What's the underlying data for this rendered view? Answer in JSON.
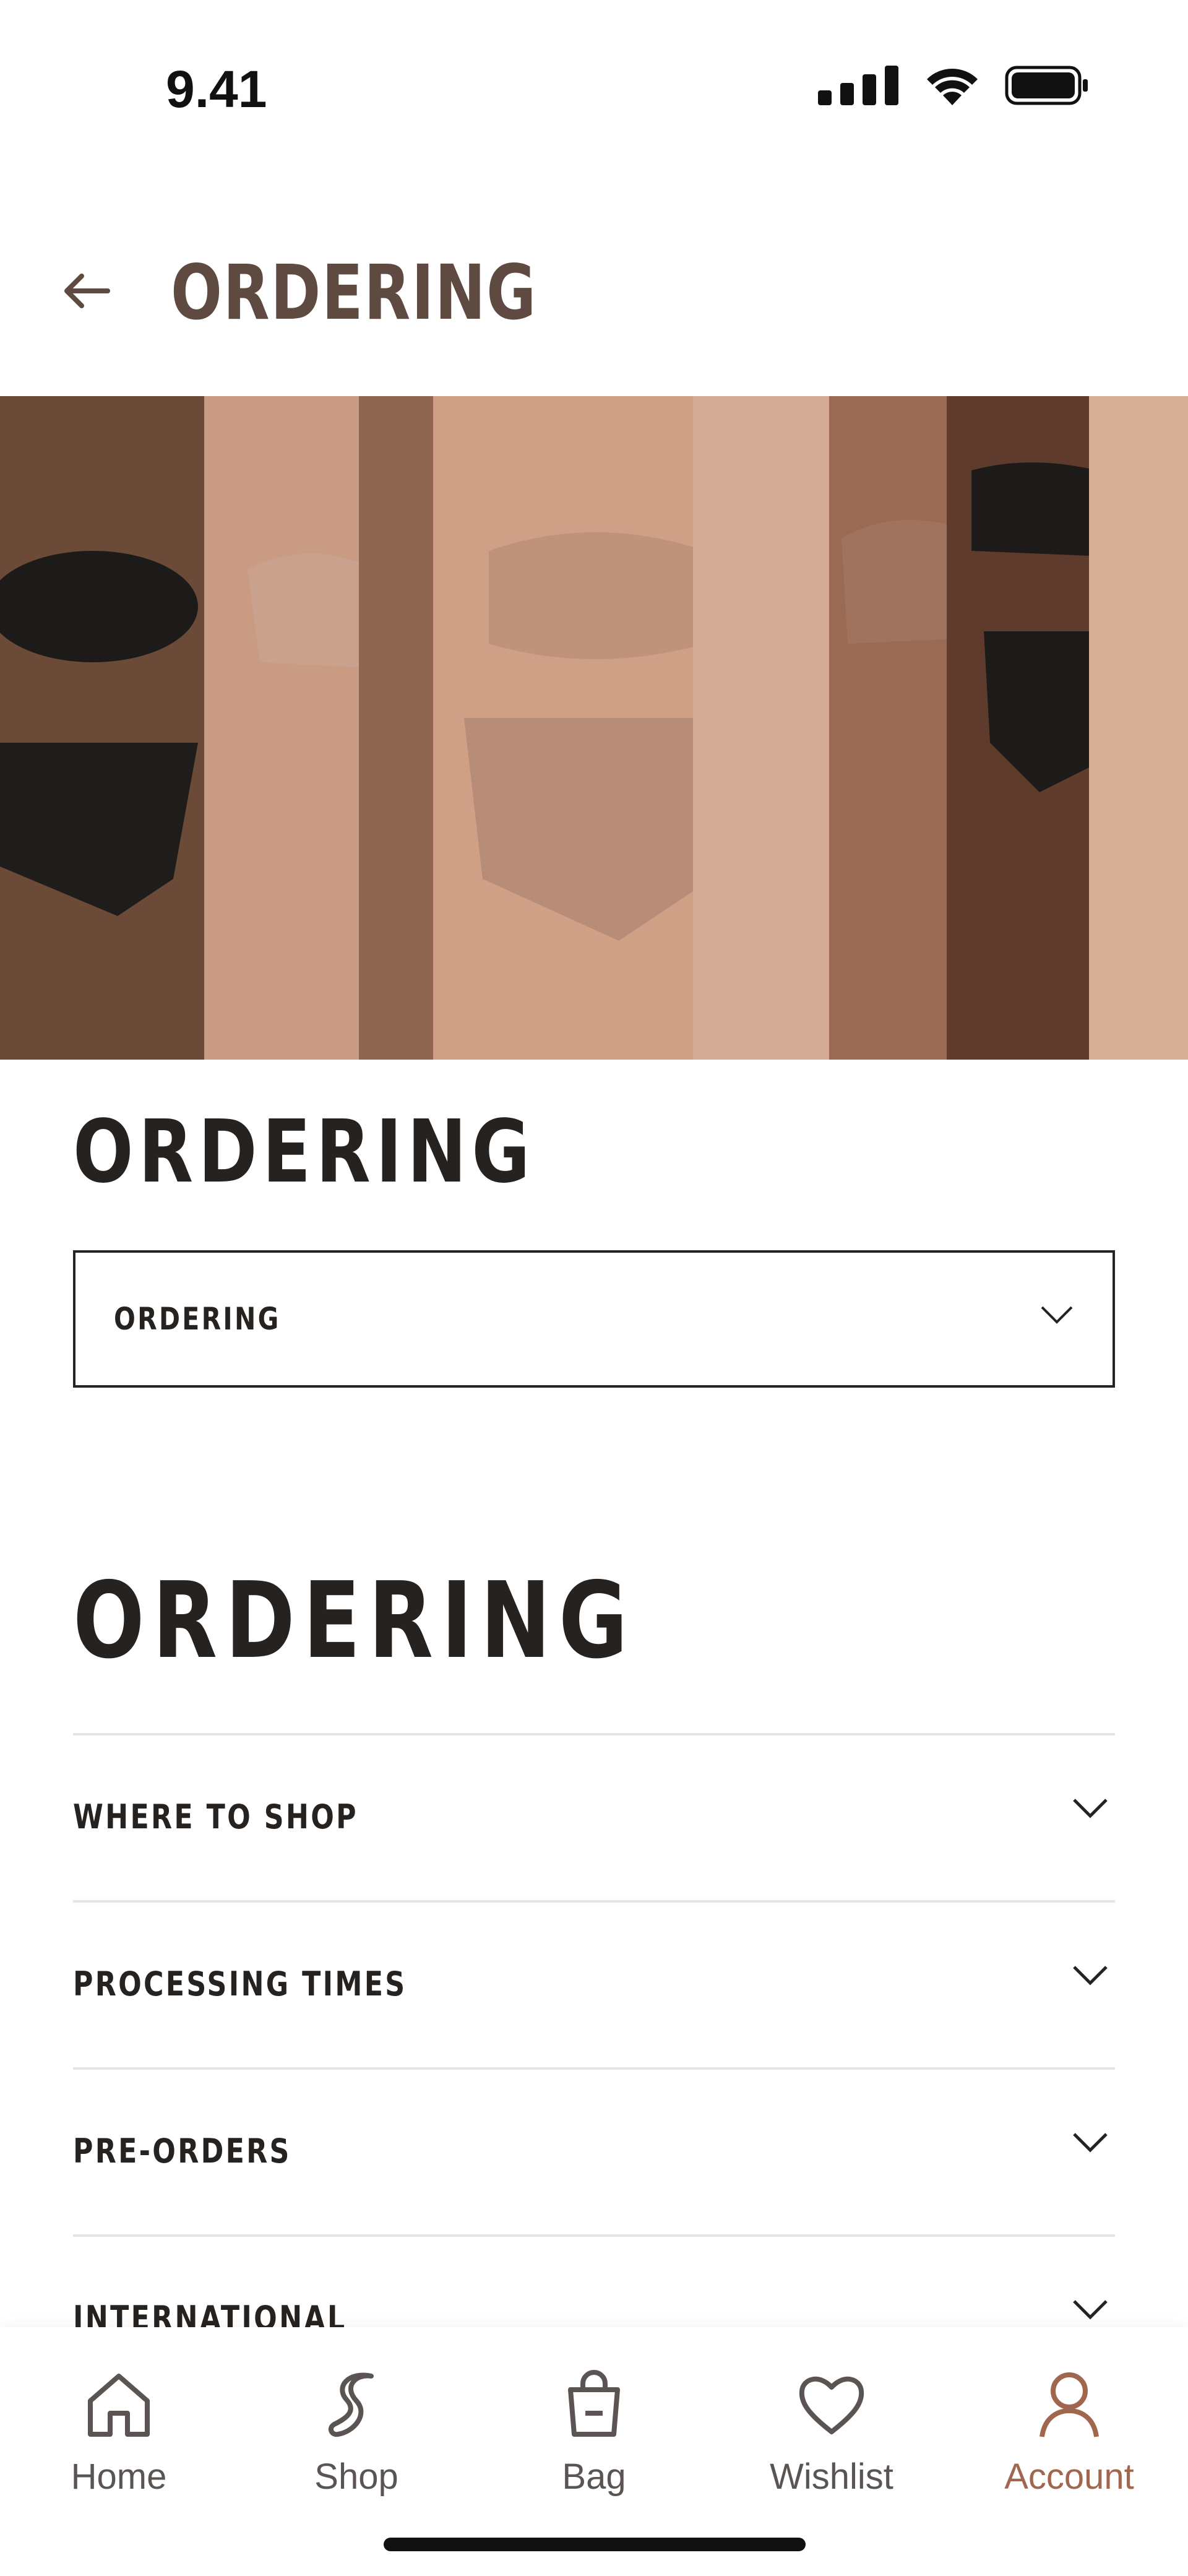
{
  "status_bar": {
    "time": "9.41"
  },
  "header": {
    "title": "ORDERING",
    "back_icon": "arrow-left-icon"
  },
  "hero": {
    "image": "models-in-underwear-photo"
  },
  "section": {
    "title": "ORDERING"
  },
  "category_select": {
    "value": "ORDERING"
  },
  "faq": {
    "title": "ORDERING",
    "items": [
      {
        "label": "WHERE TO SHOP"
      },
      {
        "label": "PROCESSING TIMES"
      },
      {
        "label": "PRE-ORDERS"
      },
      {
        "label": "INTERNATIONAL"
      }
    ]
  },
  "tabbar": {
    "items": [
      {
        "label": "Home",
        "icon": "home-icon"
      },
      {
        "label": "Shop",
        "icon": "shop-icon"
      },
      {
        "label": "Bag",
        "icon": "bag-icon"
      },
      {
        "label": "Wishlist",
        "icon": "heart-icon"
      },
      {
        "label": "Account",
        "icon": "person-icon",
        "active": true
      }
    ]
  },
  "colors": {
    "accent": "#a0664e",
    "header_title": "#5e4a40",
    "text": "#26221f"
  }
}
